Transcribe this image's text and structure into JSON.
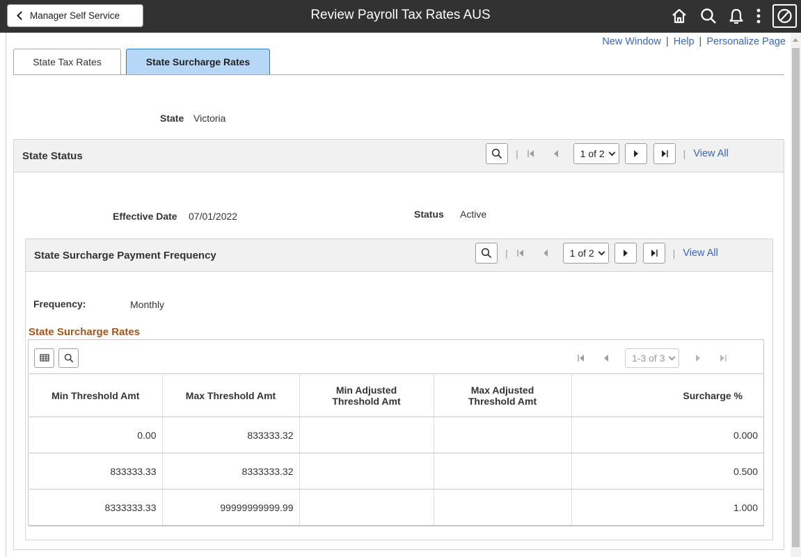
{
  "header": {
    "back_label": "Manager Self Service",
    "title": "Review Payroll Tax Rates AUS",
    "icons": [
      "home-icon",
      "search-icon",
      "bell-icon",
      "more-vertical-icon",
      "navbar-icon"
    ]
  },
  "links": {
    "new_window": "New Window",
    "help": "Help",
    "personalize": "Personalize Page",
    "separator": "|"
  },
  "tabs": [
    {
      "label": "State Tax Rates",
      "active": false
    },
    {
      "label": "State Surcharge Rates",
      "active": true
    }
  ],
  "state": {
    "label": "State",
    "value": "Victoria"
  },
  "state_status": {
    "title": "State Status",
    "pager": "1 of 2",
    "view_all": "View All",
    "effective_date_label": "Effective Date",
    "effective_date": "07/01/2022",
    "status_label": "Status",
    "status": "Active"
  },
  "payment_frequency": {
    "title": "State Surcharge Payment Frequency",
    "pager": "1 of 2",
    "view_all": "View All",
    "frequency_label": "Frequency:",
    "frequency": "Monthly"
  },
  "rates_grid": {
    "title": "State Surcharge Rates",
    "pager": "1-3 of 3",
    "columns": [
      {
        "line1": "Min Threshold Amt",
        "line2": ""
      },
      {
        "line1": "Max Threshold Amt",
        "line2": ""
      },
      {
        "line1": "Min Adjusted",
        "line2": "Threshold Amt"
      },
      {
        "line1": "Max Adjusted",
        "line2": "Threshold Amt"
      },
      {
        "line1": "Surcharge %",
        "line2": ""
      }
    ],
    "rows": [
      [
        "0.00",
        "833333.32",
        "",
        "",
        "0.000"
      ],
      [
        "833333.33",
        "8333333.32",
        "",
        "",
        "0.500"
      ],
      [
        "8333333.33",
        "99999999999.99",
        "",
        "",
        "1.000"
      ]
    ]
  },
  "colors": {
    "topbar": "#323232",
    "link": "#3768b8",
    "active_tab": "#b6d7f6",
    "section_title": "#a4551b"
  }
}
